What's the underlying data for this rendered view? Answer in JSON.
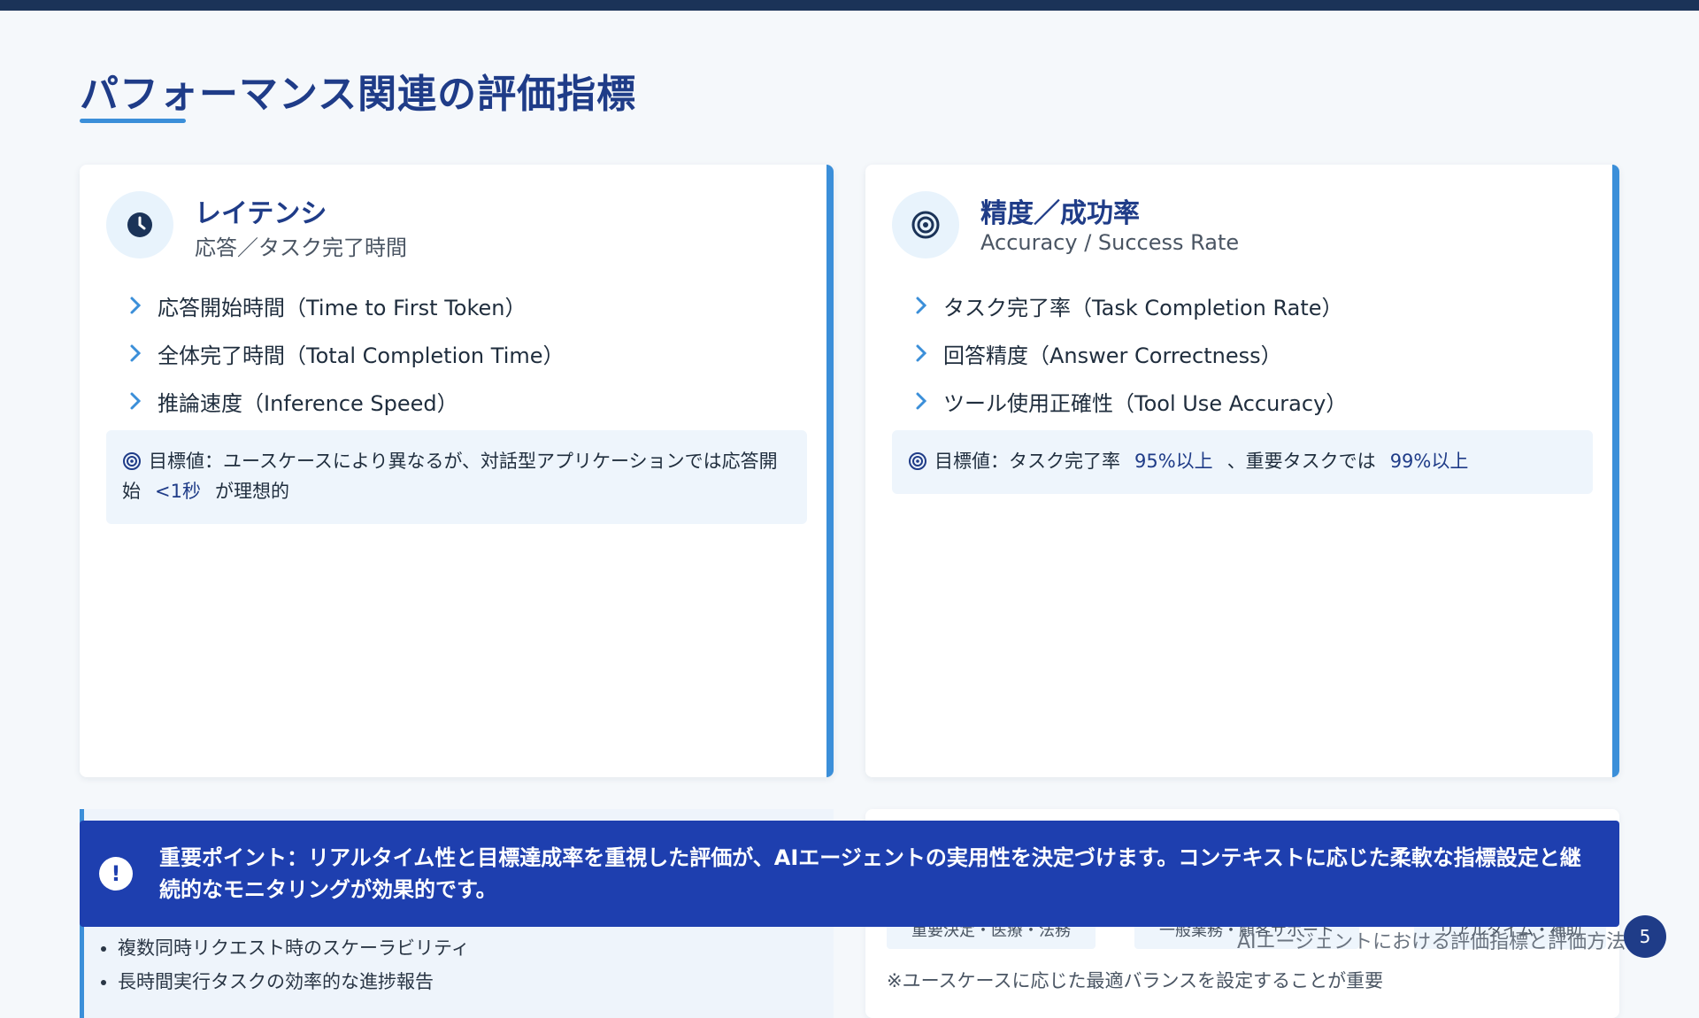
{
  "page": {
    "title": "パフォーマンス関連の評価指標"
  },
  "cards": {
    "latency": {
      "icon": "clock-icon",
      "title": "レイテンシ",
      "subtitle": "応答／タスク完了時間",
      "items": [
        "応答開始時間（Time to First Token）",
        "全体完了時間（Total Completion Time）",
        "推論速度（Inference Speed）"
      ],
      "target": {
        "prefix": "目標値：ユースケースにより異なるが、対話型アプリケーションでは応答開始",
        "highlight": "<1秒",
        "suffix": "が理想的"
      }
    },
    "accuracy": {
      "icon": "target-icon",
      "title": "精度／成功率",
      "subtitle": "Accuracy / Success Rate",
      "items": [
        "タスク完了率（Task Completion Rate）",
        "回答精度（Answer Correctness）",
        "ツール使用正確性（Tool Use Accuracy）"
      ],
      "target": {
        "prefix": "目標値：タスク完了率",
        "highlight1": "95%以上",
        "middle": "、重要タスクでは",
        "highlight2": "99%以上"
      }
    }
  },
  "bottom_left": {
    "items": [
      "複数同時リクエスト時のスケーラビリティ",
      "長時間実行タスクの効率的な進捗報告"
    ]
  },
  "bottom_right": {
    "chips": [
      "重要決定・医療・法務",
      "一般業務・顧客サポート",
      "リアルタイム・補助"
    ],
    "note": "※ユースケースに応じた最適バランスを設定することが重要"
  },
  "callout": {
    "text": "重要ポイント：リアルタイム性と目標達成率を重視した評価が、AIエージェントの実用性を決定づけます。コンテキストに応じた柔軟な指標設定と継続的なモニタリングが効果的です。"
  },
  "footer": {
    "text": "AIエージェントにおける評価指標と評価方法",
    "page_number": "5"
  },
  "colors": {
    "accent": "#3b8fd9",
    "title": "#1f3c88",
    "callout": "#1e3faf"
  }
}
